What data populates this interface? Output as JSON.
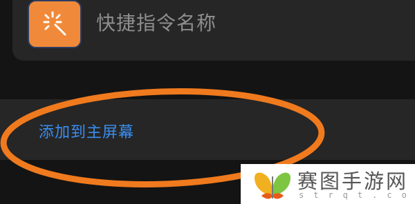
{
  "shortcut": {
    "icon": "sparkle-wand-icon",
    "name": "快捷指令名称"
  },
  "action": {
    "add_to_home_label": "添加到主屏幕"
  },
  "colors": {
    "background": "#141414",
    "card": "#262626",
    "icon_bg": "#f08a3a",
    "action_text": "#3a8ef0",
    "annotation": "#f07a1e"
  },
  "watermark": {
    "text": "赛图手游网",
    "sub": "strqt.com",
    "logo": "butterfly-logo-icon"
  }
}
